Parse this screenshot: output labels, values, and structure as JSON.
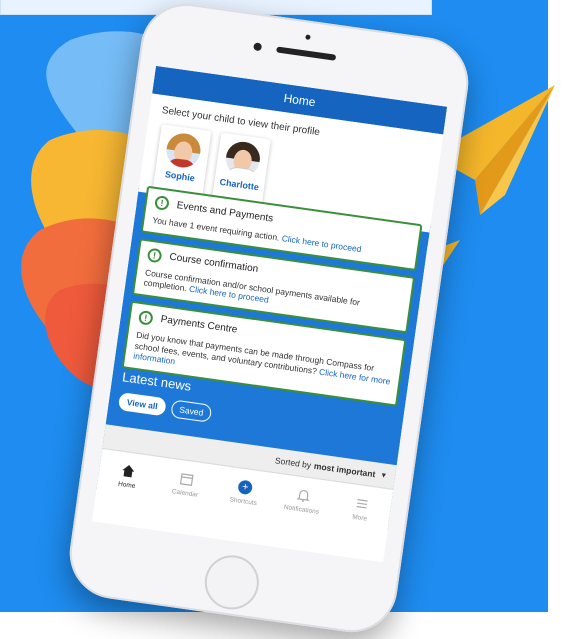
{
  "header": {
    "title": "Home"
  },
  "profile": {
    "prompt": "Select your child to view their profile",
    "children": [
      {
        "name": "Sophie"
      },
      {
        "name": "Charlotte"
      }
    ]
  },
  "cards": [
    {
      "title": "Events and Payments",
      "body": "You have 1 event requiring action.",
      "link": "Click here to proceed"
    },
    {
      "title": "Course confirmation",
      "body": "Course confirmation and/or school payments available for completion.",
      "link": "Click here to proceed"
    },
    {
      "title": "Payments Centre",
      "body": "Did you know that payments can be made through Compass for school fees, events, and voluntary contributions?",
      "link": "Click here for more information"
    }
  ],
  "news": {
    "title": "Latest news",
    "view_all": "View all",
    "saved": "Saved"
  },
  "sort": {
    "prefix": "Sorted by",
    "value": "most important"
  },
  "tabbar": [
    {
      "label": "Home",
      "icon": "home-icon"
    },
    {
      "label": "Calendar",
      "icon": "calendar-icon"
    },
    {
      "label": "Shortcuts",
      "icon": "plus-icon"
    },
    {
      "label": "Notifications",
      "icon": "bell-icon"
    },
    {
      "label": "More",
      "icon": "menu-icon"
    }
  ],
  "colors": {
    "background": "#1e8cf0",
    "app_header": "#1565c0",
    "card_border": "#3a8f3a",
    "plane": "#f4b62a"
  }
}
